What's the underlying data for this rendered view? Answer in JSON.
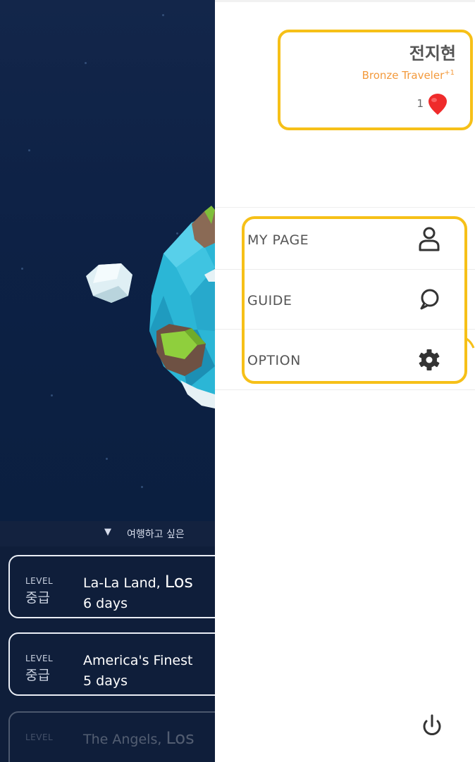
{
  "background": {
    "hint_text": "여행하고 싶은",
    "hint_arrow": "▼",
    "courses": [
      {
        "level_label": "LEVEL",
        "level_value": "중급",
        "title_prefix": "La-La Land, ",
        "title_big": "Los",
        "days": "6 days"
      },
      {
        "level_label": "LEVEL",
        "level_value": "중급",
        "title_prefix": "America's Finest",
        "title_big": "",
        "days": "5 days"
      },
      {
        "level_label": "LEVEL",
        "level_value": "",
        "title_prefix": "The Angels, ",
        "title_big": "Los",
        "days": ""
      }
    ]
  },
  "drawer": {
    "profile": {
      "name": "전지현",
      "rank": "Bronze Traveler",
      "rank_sup": "+1",
      "pin_count": "1",
      "pin_icon": "map-pin-icon",
      "pin_color": "#ef2b2b"
    },
    "menu": [
      {
        "label": "MY PAGE",
        "icon": "person-icon"
      },
      {
        "label": "GUIDE",
        "icon": "speech-bubble-icon"
      },
      {
        "label": "OPTION",
        "icon": "gear-icon"
      }
    ],
    "power_icon": "power-icon"
  },
  "colors": {
    "highlight": "#f6c018",
    "rank": "#f39a3c",
    "space": "#0d2145"
  }
}
